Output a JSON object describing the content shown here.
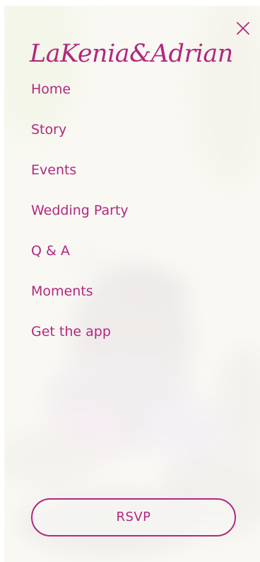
{
  "header": {
    "logo_text": "LaKenia&Adrian",
    "close_icon": "close-x-icon"
  },
  "nav": {
    "items": [
      {
        "label": "Home"
      },
      {
        "label": "Story"
      },
      {
        "label": "Events"
      },
      {
        "label": "Wedding Party"
      },
      {
        "label": "Q & A"
      },
      {
        "label": "Moments"
      },
      {
        "label": "Get the app"
      }
    ]
  },
  "rsvp": {
    "label": "RSVP"
  },
  "colors": {
    "accent": "#b2287f",
    "panel_background": "#f9f8f3"
  }
}
